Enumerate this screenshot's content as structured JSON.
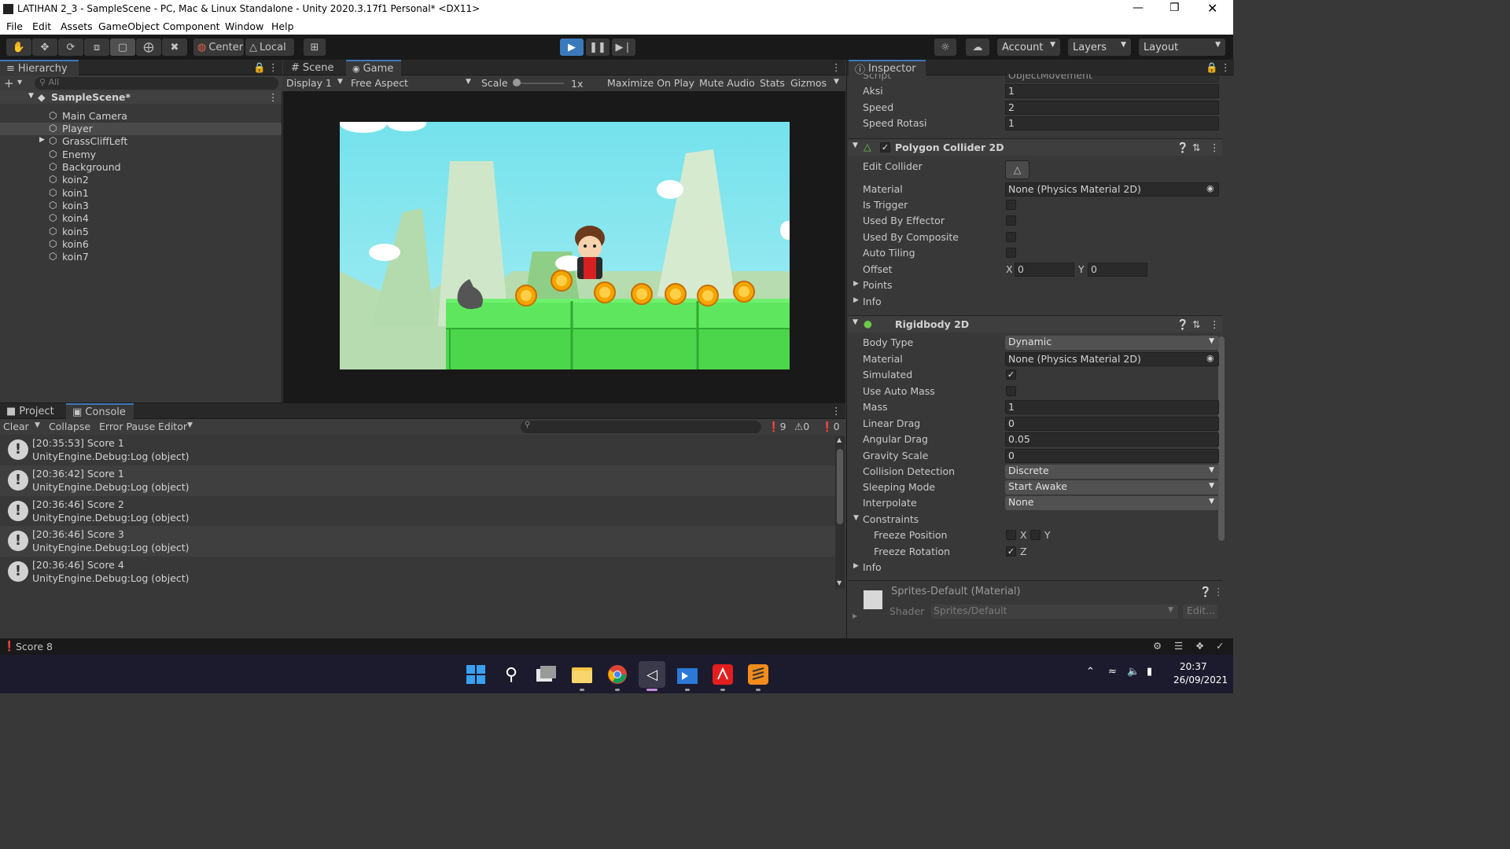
{
  "window": {
    "title": "LATIHAN 2_3 - SampleScene - PC, Mac & Linux Standalone - Unity 2020.3.17f1 Personal* <DX11>"
  },
  "menu": [
    "File",
    "Edit",
    "Assets",
    "GameObject",
    "Component",
    "Window",
    "Help"
  ],
  "toolbar": {
    "pivot_label": "Center",
    "space_label": "Local",
    "account_label": "Account",
    "layers_label": "Layers",
    "layout_label": "Layout"
  },
  "hierarchy": {
    "tab": "Hierarchy",
    "search_placeholder": "All",
    "scene": "SampleScene*",
    "items": [
      "Main Camera",
      "Player",
      "GrassCliffLeft",
      "Enemy",
      "Background",
      "koin2",
      "koin1",
      "koin3",
      "koin4",
      "koin5",
      "koin6",
      "koin7"
    ]
  },
  "game_view": {
    "tab_scene": "Scene",
    "tab_game": "Game",
    "display": "Display 1",
    "aspect": "Free Aspect",
    "scale_label": "Scale",
    "scale_value": "1x",
    "maximize": "Maximize On Play",
    "mute": "Mute Audio",
    "stats": "Stats",
    "gizmos": "Gizmos"
  },
  "console": {
    "tab_project": "Project",
    "tab_console": "Console",
    "clear": "Clear",
    "collapse": "Collapse",
    "error_pause": "Error Pause",
    "editor": "Editor",
    "count_log": "9",
    "count_warn": "0",
    "count_err": "0",
    "entries": [
      {
        "line1": "[20:35:53] Score 1",
        "line2": "UnityEngine.Debug:Log (object)"
      },
      {
        "line1": "[20:36:42] Score 1",
        "line2": "UnityEngine.Debug:Log (object)"
      },
      {
        "line1": "[20:36:46] Score 2",
        "line2": "UnityEngine.Debug:Log (object)"
      },
      {
        "line1": "[20:36:46] Score 3",
        "line2": "UnityEngine.Debug:Log (object)"
      },
      {
        "line1": "[20:36:46] Score 4",
        "line2": "UnityEngine.Debug:Log (object)"
      }
    ]
  },
  "inspector": {
    "tab": "Inspector",
    "script_row": {
      "label": "Script",
      "value": "ObjectMovement"
    },
    "fields": [
      {
        "label": "Aksi",
        "value": "1"
      },
      {
        "label": "Speed",
        "value": "2"
      },
      {
        "label": "Speed Rotasi",
        "value": "1"
      }
    ],
    "polygon": {
      "title": "Polygon Collider 2D",
      "edit_collider": "Edit Collider",
      "material_label": "Material",
      "material_value": "None (Physics Material 2D)",
      "is_trigger": "Is Trigger",
      "used_by_effector": "Used By Effector",
      "used_by_composite": "Used By Composite",
      "auto_tiling": "Auto Tiling",
      "offset": "Offset",
      "offset_x_label": "X",
      "offset_x": "0",
      "offset_y_label": "Y",
      "offset_y": "0",
      "points": "Points",
      "info": "Info"
    },
    "rigidbody": {
      "title": "Rigidbody 2D",
      "body_type_label": "Body Type",
      "body_type": "Dynamic",
      "material_label": "Material",
      "material_value": "None (Physics Material 2D)",
      "simulated": "Simulated",
      "use_auto_mass": "Use Auto Mass",
      "mass_label": "Mass",
      "mass": "1",
      "linear_drag_label": "Linear Drag",
      "linear_drag": "0",
      "angular_drag_label": "Angular Drag",
      "angular_drag": "0.05",
      "gravity_label": "Gravity Scale",
      "gravity": "0",
      "collision_label": "Collision Detection",
      "collision": "Discrete",
      "sleeping_label": "Sleeping Mode",
      "sleeping": "Start Awake",
      "interpolate_label": "Interpolate",
      "interpolate": "None",
      "constraints": "Constraints",
      "freeze_pos": "Freeze Position",
      "freeze_rot": "Freeze Rotation",
      "x": "X",
      "y": "Y",
      "z": "Z",
      "info": "Info"
    },
    "material": {
      "title": "Sprites-Default (Material)",
      "shader_label": "Shader",
      "shader_value": "Sprites/Default",
      "edit": "Edit..."
    }
  },
  "statusbar": {
    "text": "Score 8"
  },
  "taskbar": {
    "time": "20:37",
    "date": "26/09/2021"
  }
}
